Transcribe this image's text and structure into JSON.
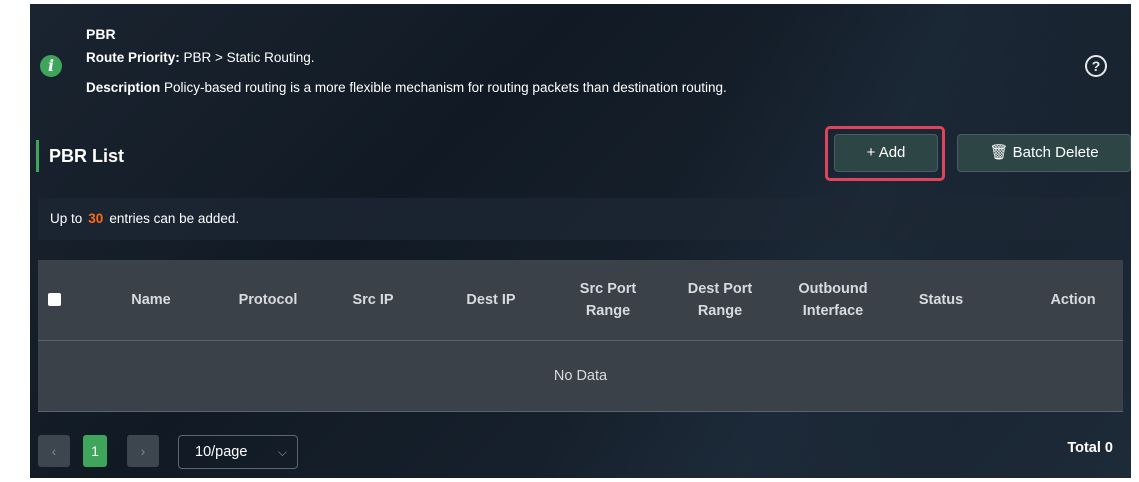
{
  "info": {
    "title": "PBR",
    "priority_label": "Route Priority:",
    "priority_text": " PBR > Static Routing.",
    "description_label": "Description",
    "description_text": " Policy-based routing is a more flexible mechanism for routing packets than destination routing."
  },
  "list": {
    "title": "PBR List",
    "add_label": "+ Add",
    "batch_delete_label": "🗑 Batch Delete",
    "note_prefix": "Up to",
    "note_count": "30",
    "note_suffix": "entries can be added."
  },
  "table": {
    "columns": [
      "Name",
      "Protocol",
      "Src IP",
      "Dest IP",
      "Src Port Range",
      "Dest Port Range",
      "Outbound Interface",
      "Status",
      "Action"
    ],
    "empty_text": "No Data"
  },
  "pager": {
    "prev": "‹",
    "current_page": "1",
    "next": "›",
    "page_size": "10/page",
    "total": "Total 0"
  },
  "colors": {
    "accent_green": "#3fa55a",
    "highlight_red": "#e0445a",
    "count_orange": "#ff6a1a"
  },
  "icons": {
    "info": "info-icon",
    "help": "question-circle-icon",
    "trash": "trash-icon",
    "chevron": "chevron-down-icon"
  }
}
